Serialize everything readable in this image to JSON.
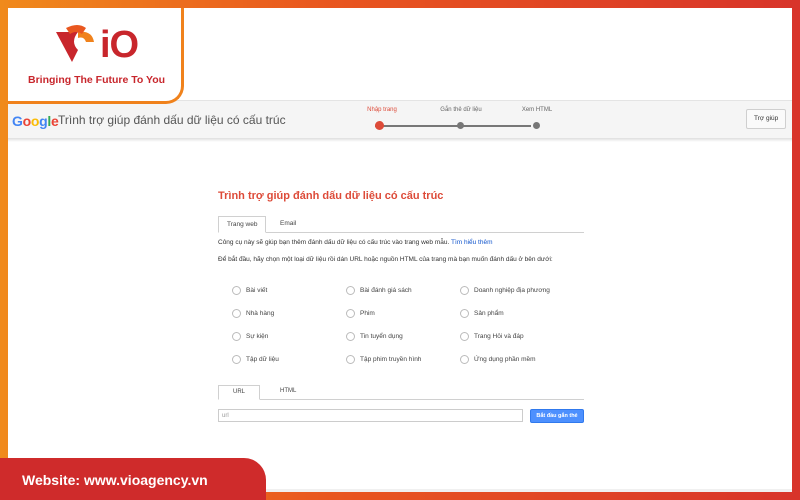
{
  "brand": {
    "logo_text": "iO",
    "tagline": "Bringing The Future To You",
    "website": "Website: www.vioagency.vn",
    "colors": {
      "primary": "#c8262c",
      "accent": "#f0821c"
    }
  },
  "header": {
    "google_logo": [
      "G",
      "o",
      "o",
      "g",
      "l",
      "e"
    ],
    "google_colors": [
      "#4285f4",
      "#ea4335",
      "#fbbc05",
      "#4285f4",
      "#34a853",
      "#ea4335"
    ],
    "title": "Trình trợ giúp đánh dấu dữ liệu có cấu trúc",
    "steps": [
      "Nhập trang",
      "Gắn thẻ dữ liệu",
      "Xem HTML"
    ],
    "active_step": 0,
    "help_button": "Trợ giúp"
  },
  "main": {
    "title": "Trình trợ giúp đánh dấu dữ liệu có cấu trúc",
    "tabs": [
      "Trang web",
      "Email"
    ],
    "active_tab": 0,
    "description": "Công cụ này sẽ giúp bạn thêm đánh dấu dữ liệu có cấu trúc vào trang web mẫu. ",
    "learn_more": "Tìm hiểu thêm",
    "instruction": "Để bắt đầu, hãy chọn một loại dữ liệu rồi dán URL hoặc nguồn HTML của trang mà bạn muốn đánh dấu ở bên dưới:",
    "options": [
      [
        "Bài viết",
        "Bài đánh giá sách",
        "Doanh nghiệp địa phương"
      ],
      [
        "Nhà hàng",
        "Phim",
        "Sản phẩm"
      ],
      [
        "Sự kiện",
        "Tin tuyển dụng",
        "Trang Hỏi và đáp"
      ],
      [
        "Tập dữ liệu",
        "Tập phim truyền hình",
        "Ứng dụng phần mềm"
      ]
    ],
    "input_tabs": [
      "URL",
      "HTML"
    ],
    "url_placeholder": "url",
    "start_button": "Bắt đầu gắn thẻ"
  }
}
